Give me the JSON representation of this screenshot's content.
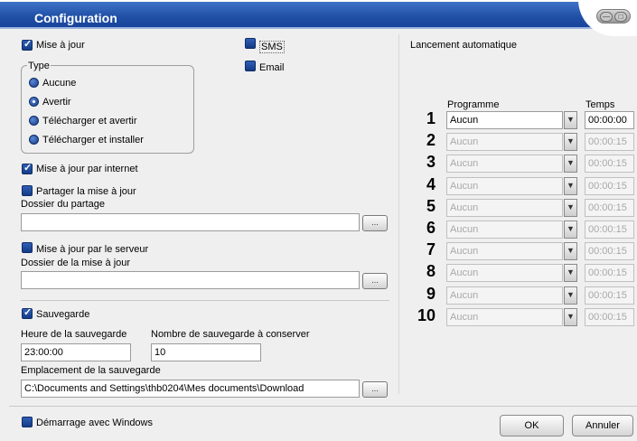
{
  "window": {
    "title": "Configuration"
  },
  "left": {
    "update_checkbox": {
      "label": "Mise à jour",
      "checked": true
    },
    "type_group": {
      "legend": "Type",
      "options": [
        {
          "label": "Aucune",
          "selected": false
        },
        {
          "label": "Avertir",
          "selected": true
        },
        {
          "label": "Télécharger et avertir",
          "selected": false
        },
        {
          "label": "Télécharger et installer",
          "selected": false
        }
      ]
    },
    "sms_checkbox": {
      "label": "SMS",
      "checked": false
    },
    "email_checkbox": {
      "label": "Email",
      "checked": false
    },
    "internet_update": {
      "label": "Mise à jour par internet",
      "checked": true
    },
    "share_update": {
      "label": "Partager la mise à jour",
      "checked": false
    },
    "share_folder": {
      "label": "Dossier du partage",
      "value": ""
    },
    "server_update": {
      "label": "Mise à jour par le serveur",
      "checked": false
    },
    "update_folder": {
      "label": "Dossier de la mise à jour",
      "value": ""
    },
    "backup": {
      "label": "Sauvegarde",
      "checked": true
    },
    "backup_time": {
      "label": "Heure de la sauvegarde",
      "value": "23:00:00"
    },
    "backup_count": {
      "label": "Nombre de sauvegarde à conserver",
      "value": "10"
    },
    "backup_location": {
      "label": "Emplacement de la sauvegarde",
      "value": "C:\\Documents and Settings\\thb0204\\Mes documents\\Download"
    },
    "browse_label": "...",
    "startup": {
      "label": "Démarrage avec Windows",
      "checked": false
    }
  },
  "right": {
    "heading": "Lancement automatique",
    "col_program": "Programme",
    "col_time": "Temps",
    "rows": [
      {
        "num": "1",
        "program": "Aucun",
        "time": "00:00:00",
        "enabled": true
      },
      {
        "num": "2",
        "program": "Aucun",
        "time": "00:00:15",
        "enabled": false
      },
      {
        "num": "3",
        "program": "Aucun",
        "time": "00:00:15",
        "enabled": false
      },
      {
        "num": "4",
        "program": "Aucun",
        "time": "00:00:15",
        "enabled": false
      },
      {
        "num": "5",
        "program": "Aucun",
        "time": "00:00:15",
        "enabled": false
      },
      {
        "num": "6",
        "program": "Aucun",
        "time": "00:00:15",
        "enabled": false
      },
      {
        "num": "7",
        "program": "Aucun",
        "time": "00:00:15",
        "enabled": false
      },
      {
        "num": "8",
        "program": "Aucun",
        "time": "00:00:15",
        "enabled": false
      },
      {
        "num": "9",
        "program": "Aucun",
        "time": "00:00:15",
        "enabled": false
      },
      {
        "num": "10",
        "program": "Aucun",
        "time": "00:00:15",
        "enabled": false
      }
    ]
  },
  "footer": {
    "ok": "OK",
    "cancel": "Annuler"
  }
}
